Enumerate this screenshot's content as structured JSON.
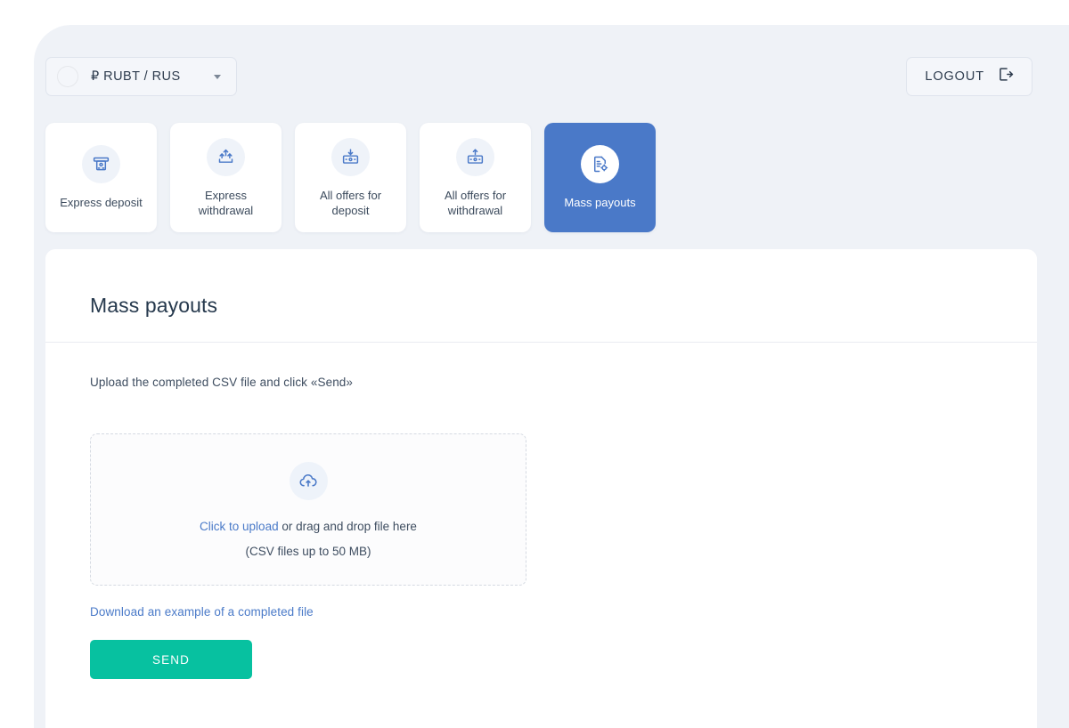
{
  "header": {
    "currency": {
      "label": "₽ RUBT / RUS",
      "flag_icon": "russia-flag-icon",
      "chevron_icon": "chevron-down-icon"
    },
    "logout": {
      "label": "LOGOUT",
      "icon": "logout-arrow-icon"
    }
  },
  "nav": {
    "tiles": [
      {
        "label": "Express deposit",
        "icon": "atm-deposit-icon",
        "active": false
      },
      {
        "label": "Express withdrawal",
        "icon": "withdrawal-arrows-icon",
        "active": false
      },
      {
        "label": "All offers for deposit",
        "icon": "card-deposit-icon",
        "active": false
      },
      {
        "label": "All offers for withdrawal",
        "icon": "card-withdrawal-icon",
        "active": false
      },
      {
        "label": "Mass payouts",
        "icon": "document-gear-icon",
        "active": true
      }
    ]
  },
  "main": {
    "title": "Mass payouts",
    "upload_hint": "Upload the completed CSV file and click «Send»",
    "dropzone": {
      "icon": "cloud-upload-icon",
      "link_text": "Click to upload",
      "rest_text": " or drag and drop file here",
      "size_note": "(CSV files up to 50 MB)"
    },
    "example_link": "Download an example of a completed file",
    "send_label": "SEND"
  },
  "colors": {
    "accent_blue": "#4a79c8",
    "send_green": "#07c1a0",
    "page_bg": "#eff2f7",
    "card_bg": "#ffffff",
    "title_text": "#26394d"
  }
}
